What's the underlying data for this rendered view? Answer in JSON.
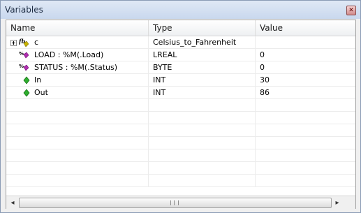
{
  "window": {
    "title": "Variables"
  },
  "columns": {
    "name": "Name",
    "type": "Type",
    "value": "Value"
  },
  "rows": [
    {
      "name": "c",
      "type": "Celsius_to_Fahrenheit",
      "value": "",
      "icon": "function-block-icon",
      "expandable": true
    },
    {
      "name": "LOAD : %M(.Load)",
      "type": "LREAL",
      "value": "0",
      "icon": "memory-variable-icon",
      "expandable": false
    },
    {
      "name": "STATUS : %M(.Status)",
      "type": "BYTE",
      "value": "0",
      "icon": "memory-variable-icon",
      "expandable": false
    },
    {
      "name": "In",
      "type": "INT",
      "value": "30",
      "icon": "variable-icon",
      "expandable": false
    },
    {
      "name": "Out",
      "type": "INT",
      "value": "86",
      "icon": "variable-icon",
      "expandable": false
    }
  ],
  "scrollbar": {
    "left_arrow": "◂",
    "right_arrow": "▸"
  },
  "colors": {
    "titlebar": "#c9d8ee",
    "variable_icon": "#2fae2f",
    "memory_icon": "#b02fb0"
  }
}
